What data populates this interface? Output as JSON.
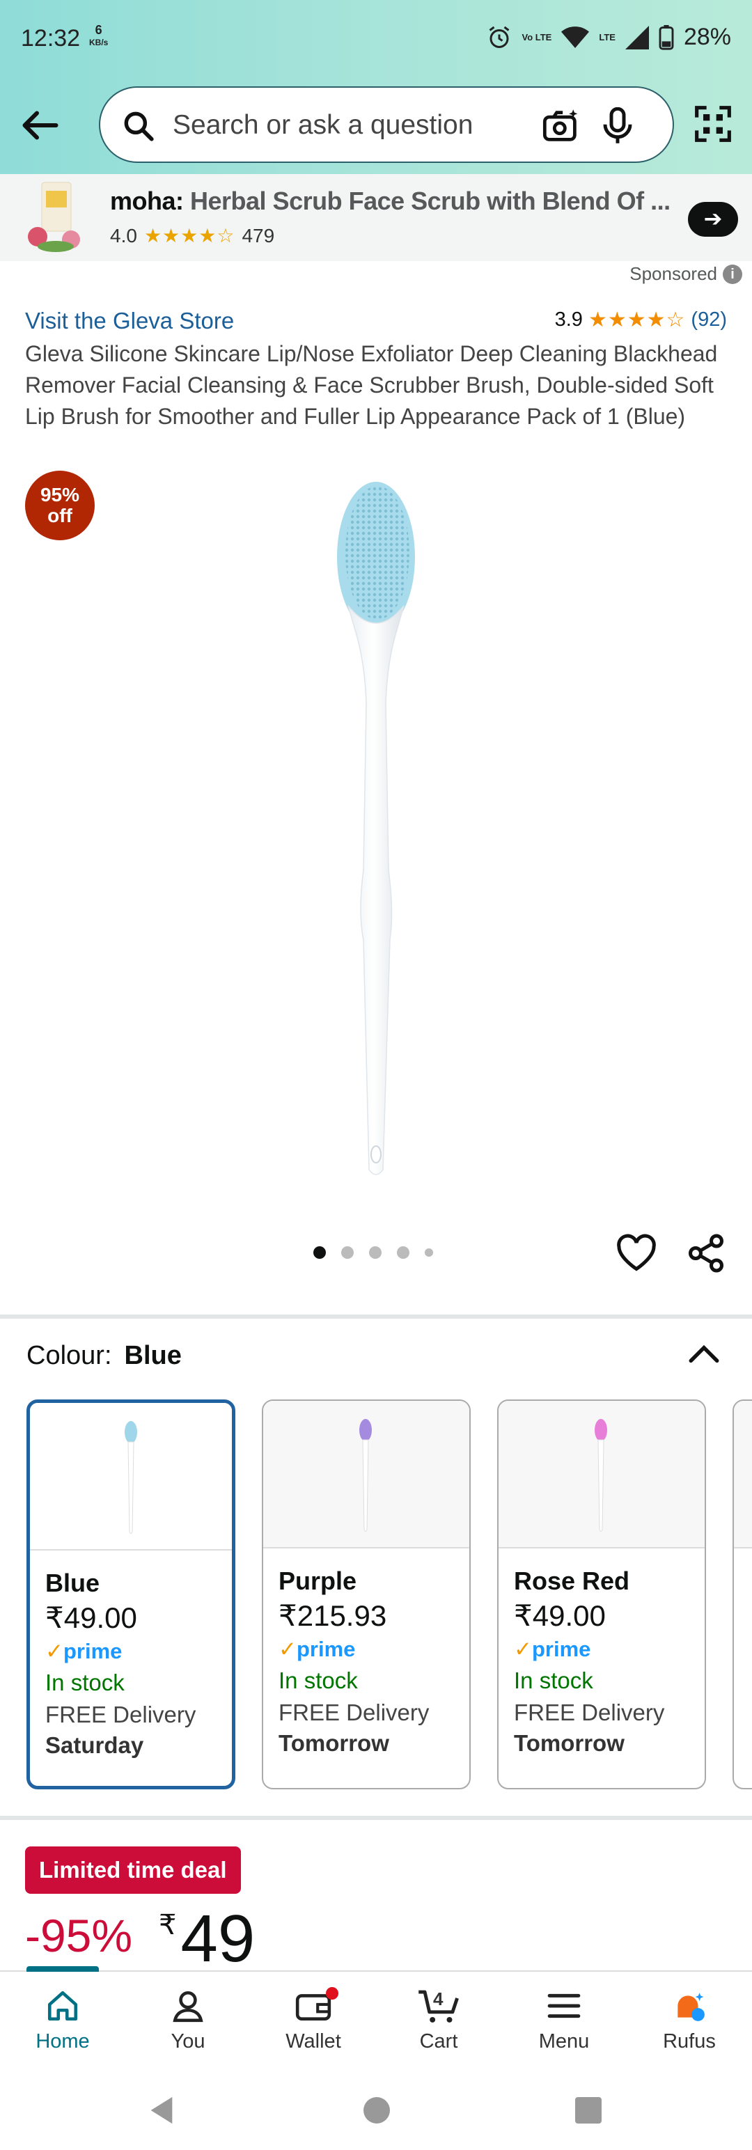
{
  "status_bar": {
    "time": "12:32",
    "net_speed": "6",
    "net_unit": "KB/s",
    "volte": "Vo LTE",
    "lte": "LTE",
    "battery": "28%"
  },
  "search": {
    "placeholder": "Search or ask a question"
  },
  "banner": {
    "brand": "moha:",
    "product": "Herbal Scrub Face Scrub with Blend Of ...",
    "rating": "4.0",
    "stars": "★★★★☆",
    "reviews": "479",
    "sponsored": "Sponsored"
  },
  "product": {
    "store_link": "Visit the Gleva Store",
    "rating": "3.9",
    "stars": "★★★★☆",
    "review_count": "(92)",
    "title": "Gleva Silicone Skincare Lip/Nose Exfoliator Deep Cleaning Blackhead Remover Facial Cleansing & Face Scrubber Brush, Double-sided Soft Lip Brush for Smoother and Fuller Lip Appearance Pack of 1 (Blue)",
    "off_pct": "95%",
    "off_word": "off",
    "image_count": 5,
    "image_index": 1
  },
  "colour": {
    "label": "Colour:",
    "selected": "Blue",
    "options": [
      {
        "name": "Blue",
        "price": "₹49.00",
        "prime": "prime",
        "stock": "In stock",
        "delivery": "FREE Delivery",
        "day": "Saturday",
        "color": "#9fd6ea"
      },
      {
        "name": "Purple",
        "price": "₹215.93",
        "prime": "prime",
        "stock": "In stock",
        "delivery": "FREE Delivery",
        "day": "Tomorrow",
        "color": "#a48be0"
      },
      {
        "name": "Rose Red",
        "price": "₹49.00",
        "prime": "prime",
        "stock": "In stock",
        "delivery": "FREE Delivery",
        "day": "Tomorrow",
        "color": "#e77ed8"
      }
    ]
  },
  "deal": {
    "badge": "Limited time deal",
    "discount": "-95%",
    "currency": "₹",
    "price": "49"
  },
  "nav": {
    "home": "Home",
    "you": "You",
    "wallet": "Wallet",
    "cart": "Cart",
    "cart_count": "4",
    "menu": "Menu",
    "rufus": "Rufus"
  },
  "colors": {
    "accent_teal": "#007185",
    "link_blue": "#1b5e98",
    "deal_red": "#cc0c39",
    "badge_red": "#b12704",
    "stock_green": "#007600"
  }
}
